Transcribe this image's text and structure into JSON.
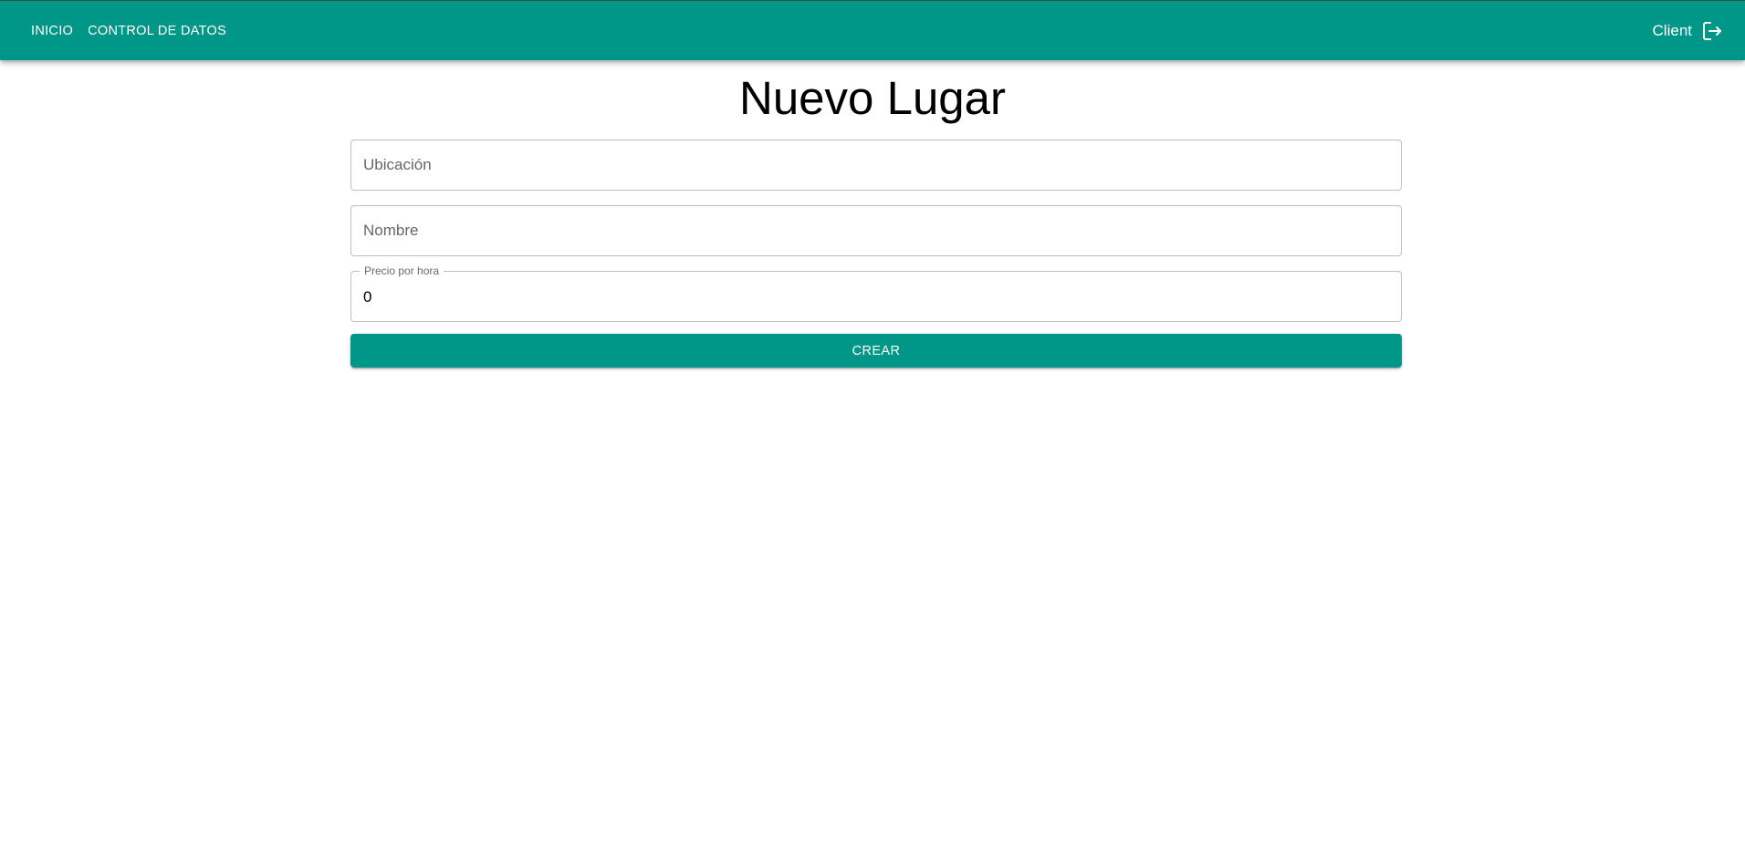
{
  "colors": {
    "primary": "#009688",
    "on_primary": "#ffffff",
    "border": "#bdbdbd",
    "placeholder": "#666666"
  },
  "navbar": {
    "items": [
      {
        "label": "INICIO"
      },
      {
        "label": "CONTROL DE DATOS"
      }
    ],
    "user": {
      "name": "Client",
      "logout_icon": "logout-icon"
    }
  },
  "page": {
    "title": "Nuevo Lugar"
  },
  "form": {
    "location": {
      "placeholder": "Ubicación",
      "value": ""
    },
    "name": {
      "placeholder": "Nombre",
      "value": ""
    },
    "price": {
      "label": "Precio por hora",
      "value": "0"
    },
    "submit_label": "CREAR"
  }
}
